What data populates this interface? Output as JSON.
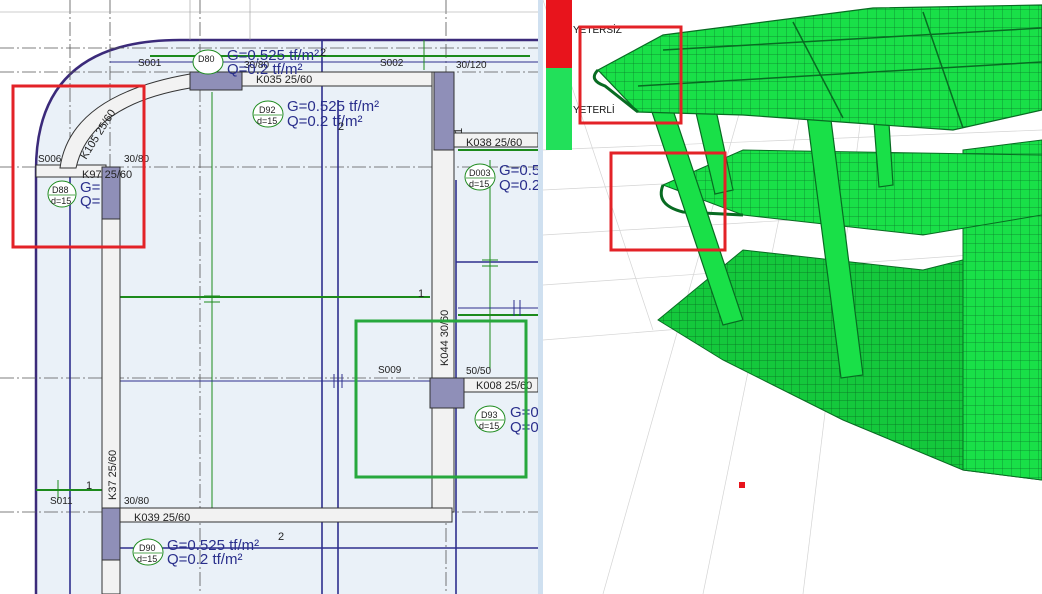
{
  "plan": {
    "slab_labels": [
      "S001",
      "S002",
      "S006",
      "S009",
      "S011"
    ],
    "beams": {
      "k035": "K035 25/60",
      "k038": "K038 25/60",
      "k97": "K97 25/60",
      "k105": "K105 25/60",
      "k044": "K044 30/60",
      "k008": "K008 25/60",
      "k37": "K37 25/60",
      "k039": "K039 25/60"
    },
    "columns": {
      "c_top_right": "30/120",
      "c_mid_left": "30/80",
      "c_center": "50/50",
      "c_bottom_left": "30/80",
      "c_top_small": "30/80"
    },
    "slabs": {
      "d80": {
        "id": "D80",
        "g": "G=0.525 tf/m²",
        "q": "Q=0.2 tf/m²"
      },
      "d92": {
        "id": "D92",
        "d": "d=15",
        "g": "G=0.525 tf/m²",
        "q": "Q=0.2 tf/m²"
      },
      "d003": {
        "id": "D003",
        "d": "d=15",
        "g": "G=0.5",
        "q": "Q=0.2"
      },
      "d88": {
        "id": "D88",
        "d": "d=15",
        "g": "G=",
        "q": "Q="
      },
      "d93": {
        "id": "D93",
        "d": "d=15",
        "g": "G=0",
        "q": "Q=0"
      },
      "d90": {
        "id": "D90",
        "d": "d=15",
        "g": "G=0.525 tf/m²",
        "q": "Q=0.2 tf/m²"
      }
    },
    "marks": [
      "1",
      "1",
      "1",
      "2",
      "2",
      "2"
    ]
  },
  "view3d": {
    "legend": [
      {
        "label": "YETERSİZ",
        "color": "#e8141c"
      },
      {
        "label": "YETERLİ",
        "color": "#22e05a"
      }
    ]
  },
  "colors": {
    "highlight_red": "#e32227",
    "highlight_green": "#27a83d",
    "plan_bg": "#eaf1f8",
    "beam_fill": "#f2f2f2",
    "column_fill": "#8f8fb8",
    "model_green": "#19e048"
  }
}
